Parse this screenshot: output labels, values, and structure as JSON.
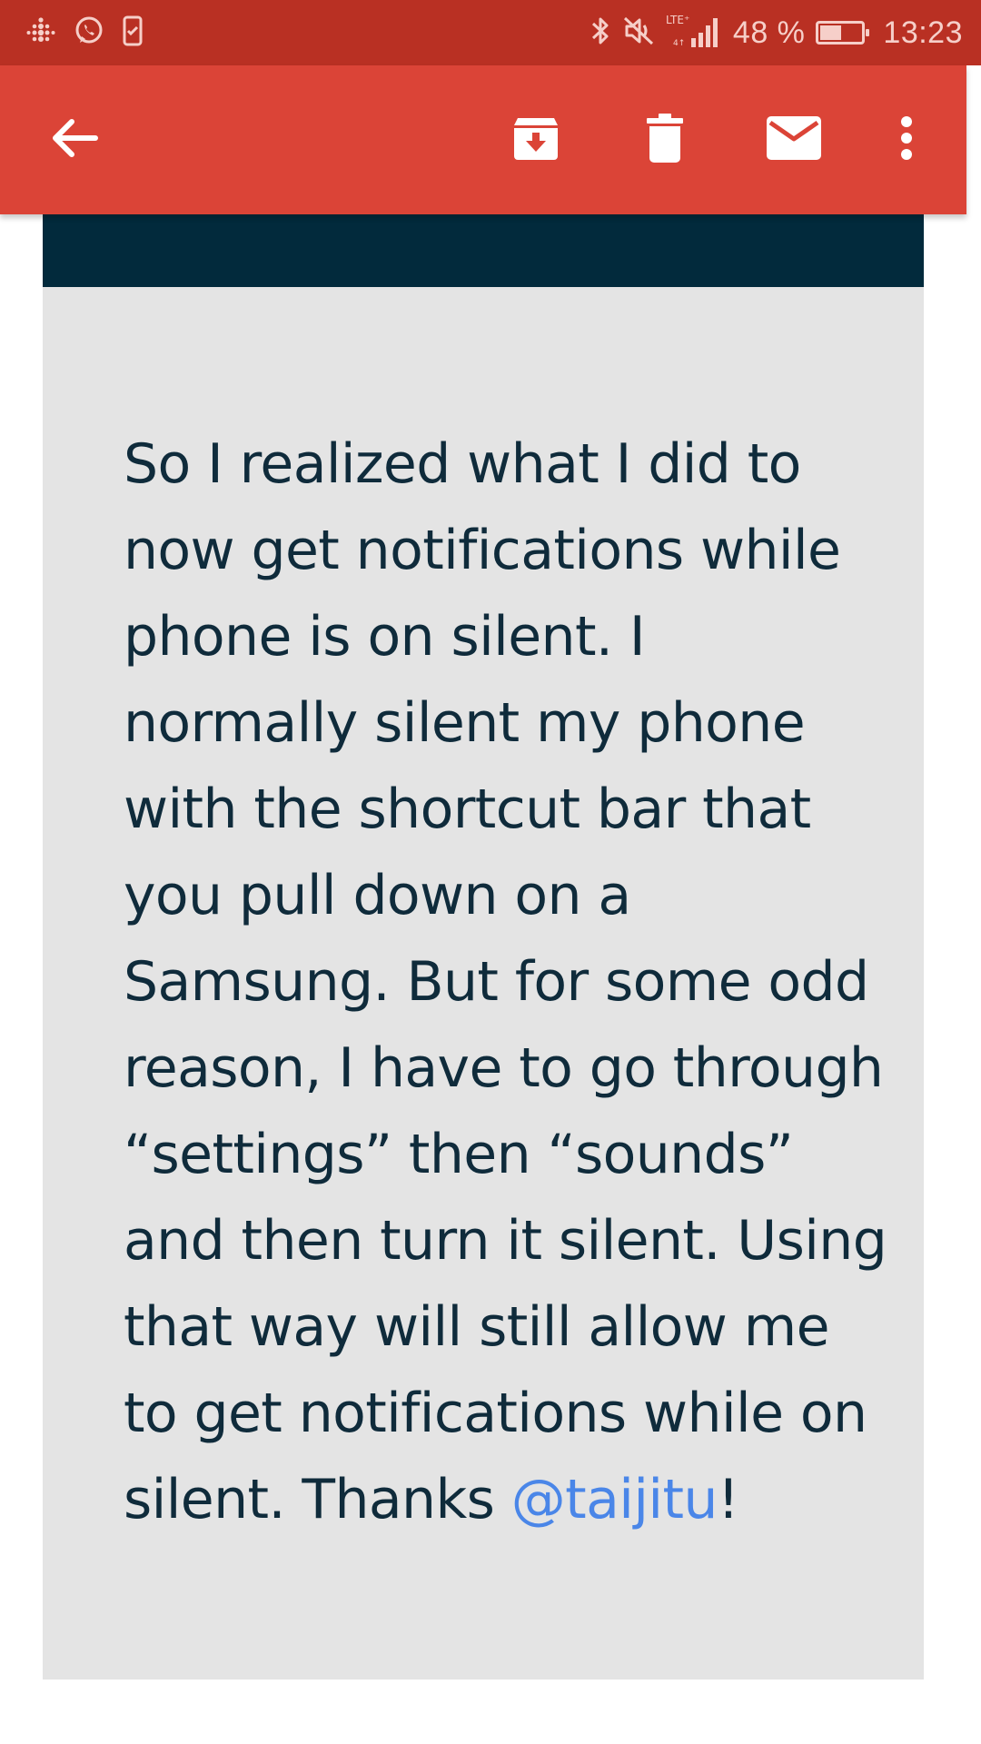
{
  "status_bar": {
    "network": "LTE",
    "battery_percent": "48 %",
    "battery_level": 0.48,
    "time": "13:23",
    "left_icons": [
      "fitbit-icon",
      "whatsapp-icon",
      "phone-check-icon"
    ],
    "right_icons": [
      "bluetooth-icon",
      "mute-icon",
      "signal-icon",
      "battery-icon"
    ]
  },
  "toolbar": {
    "icons": [
      "back-arrow-icon",
      "archive-icon",
      "delete-icon",
      "mail-icon",
      "more-vert-icon"
    ]
  },
  "email": {
    "body_text": "So I realized what I did to now get notifications while phone is on silent. I normally silent my phone with the shortcut bar that you pull down on a Samsung. But for some odd reason, I have to go through “settings” then “sounds” and then turn it silent. Using that way will still allow me to get notifications while on silent. Thanks ",
    "mention": "@taijitu",
    "ending": "!"
  },
  "colors": {
    "status_bar": "#b93023",
    "app_bar": "#db4437",
    "card_header": "#022a3c",
    "card_background": "#e4e4e4",
    "text": "#0f2b3b",
    "link": "#4a86e8"
  }
}
